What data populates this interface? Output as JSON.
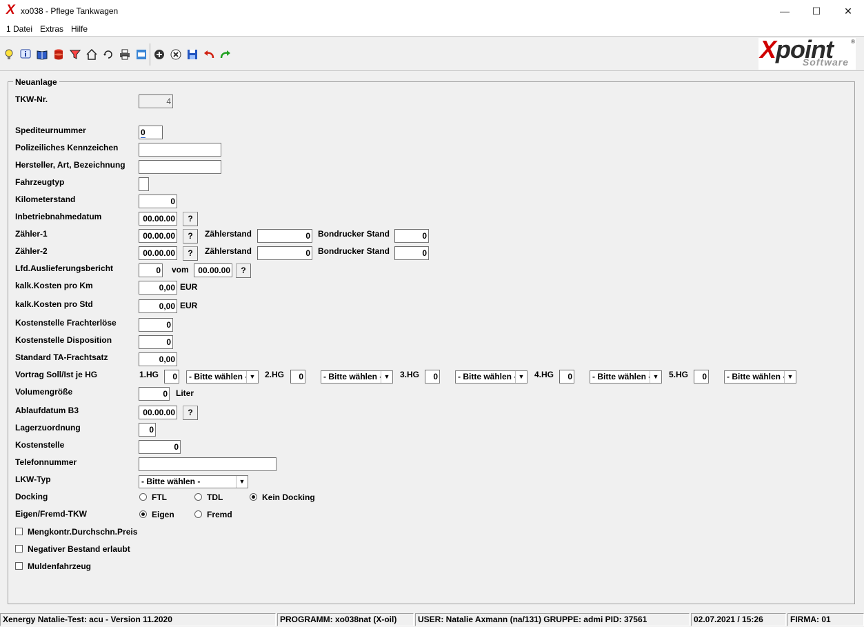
{
  "window": {
    "title": "xo038 - Pflege Tankwagen",
    "minimize_glyph": "—",
    "maximize_glyph": "☐",
    "close_glyph": "✕"
  },
  "menu": {
    "datei": "1 Datei",
    "extras": "Extras",
    "hilfe": "Hilfe"
  },
  "toolbar": {
    "icons": [
      "lightbulb-icon",
      "info-icon",
      "book-icon",
      "database-icon",
      "filter-icon",
      "home-icon",
      "refresh-icon",
      "print-icon",
      "window-icon",
      "add-icon",
      "cancel-icon",
      "save-icon",
      "undo-icon",
      "redo-icon"
    ]
  },
  "logo": {
    "brand_x": "X",
    "brand_rest": "point",
    "sub": "Software",
    "reg": "®"
  },
  "form": {
    "section_title": "Neuanlage",
    "tkw_nr_label": "TKW-Nr.",
    "tkw_nr_value": "4",
    "spediteur_label": "Spediteurnummer",
    "spediteur_value": "0",
    "kennzeichen_label": "Polizeiliches Kennzeichen",
    "kennzeichen_value": "",
    "hersteller_label": "Hersteller, Art, Bezeichnung",
    "hersteller_value": "",
    "fahrzeugtyp_label": "Fahrzeugtyp",
    "fahrzeugtyp_value": "",
    "km_label": "Kilometerstand",
    "km_value": "0",
    "inbetrieb_label": "Inbetriebnahmedatum",
    "inbetrieb_value": "00.00.00",
    "zaehler1_label": "Zähler-1",
    "zaehler1_date": "00.00.00",
    "zaehler1_stand_label": "Zählerstand",
    "zaehler1_stand": "0",
    "zaehler1_bond_label": "Bondrucker Stand",
    "zaehler1_bond": "0",
    "zaehler2_label": "Zähler-2",
    "zaehler2_date": "00.00.00",
    "zaehler2_stand_label": "Zählerstand",
    "zaehler2_stand": "0",
    "zaehler2_bond_label": "Bondrucker Stand",
    "zaehler2_bond": "0",
    "lfd_label": "Lfd.Auslieferungsbericht",
    "lfd_value": "0",
    "vom_label": "vom",
    "vom_value": "00.00.00",
    "kosten_km_label": "kalk.Kosten  pro Km",
    "kosten_km_value": "0,00",
    "kosten_std_label": "kalk.Kosten  pro Std",
    "kosten_std_value": "0,00",
    "eur": "EUR",
    "ks_fracht_label": "Kostenstelle Frachterlöse",
    "ks_fracht_value": "0",
    "ks_dispo_label": "Kostenstelle Disposition",
    "ks_dispo_value": "0",
    "ta_label": "Standard TA-Frachtsatz",
    "ta_value": "0,00",
    "vortrag_label": "Vortrag Soll/Ist je HG",
    "hg": [
      {
        "label": "1.HG",
        "value": "0",
        "select": "- Bitte wählen -"
      },
      {
        "label": "2.HG",
        "value": "0",
        "select": "- Bitte wählen -"
      },
      {
        "label": "3.HG",
        "value": "0",
        "select": "- Bitte wählen -"
      },
      {
        "label": "4.HG",
        "value": "0",
        "select": "- Bitte wählen -"
      },
      {
        "label": "5.HG",
        "value": "0",
        "select": "- Bitte wählen -"
      }
    ],
    "volumen_label": "Volumengröße",
    "volumen_value": "0",
    "liter": "Liter",
    "ablauf_label": "Ablaufdatum B3",
    "ablauf_value": "00.00.00",
    "lager_label": "Lagerzuordnung",
    "lager_value": "0",
    "kostenstelle_label": "Kostenstelle",
    "kostenstelle_value": "0",
    "telefon_label": "Telefonnummer",
    "telefon_value": "",
    "lkw_label": "LKW-Typ",
    "lkw_value": "- Bitte wählen -",
    "docking_label": "Docking",
    "docking_options": [
      "FTL",
      "TDL",
      "Kein Docking"
    ],
    "docking_selected": "Kein Docking",
    "eigen_label": "Eigen/Fremd-TKW",
    "eigen_options": [
      "Eigen",
      "Fremd"
    ],
    "eigen_selected": "Eigen",
    "chk_mengkontr": "Mengkontr.Durchschn.Preis",
    "chk_negativ": "Negativer Bestand erlaubt",
    "chk_mulden": "Muldenfahrzeug",
    "help_btn": "?",
    "arrow": "▼"
  },
  "status": {
    "app": "Xenergy Natalie-Test: acu - Version 11.2020",
    "programm": "PROGRAMM: xo038nat (X-oil)",
    "user": "USER: Natalie Axmann (na/131)  GRUPPE: admi  PID: 37561",
    "datetime": "02.07.2021 / 15:26",
    "firma": "FIRMA: 01"
  }
}
